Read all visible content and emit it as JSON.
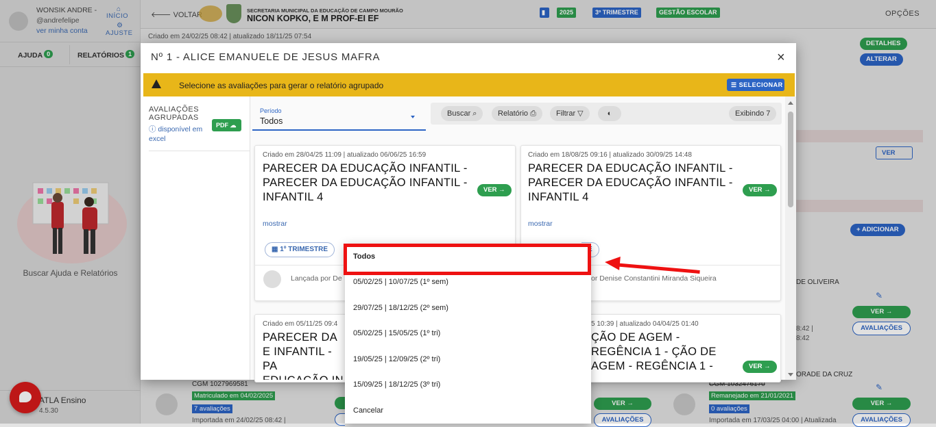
{
  "user": {
    "name": "WONSIK ANDRE -",
    "handle": "@andrefelipe",
    "my_account": "ver minha conta",
    "inicio": "INÍCIO",
    "ajuste": "AJUSTE"
  },
  "side_tabs": {
    "ajuda": "AJUDA",
    "ajuda_count": "0",
    "relatorios": "RELATÓRIOS",
    "relatorios_count": "1"
  },
  "help_text": "Buscar Ajuda e Relatórios",
  "app_footer": {
    "name": "ATLA Ensino",
    "version": "4.5.30"
  },
  "header": {
    "back": "VOLTAR",
    "secretaria": "SECRETARIA MUNICIPAL DA EDUCAÇÃO DE CAMPO MOURÃO",
    "school": "NICON KOPKO, E M PROF-EI EF",
    "chips": [
      "2025",
      "3º TRIMESTRE",
      "GESTÃO ESCOLAR"
    ],
    "options": "OPÇÕES"
  },
  "created_info": "Criado em 24/02/25 08:42 | atualizado 18/11/25 07:54",
  "background": {
    "detalhes": "DETALHES",
    "alterar": "ALTERAR",
    "ver": "VER",
    "adicionar": "+ ADICIONAR",
    "name_right": "DE OLIVEIRA",
    "date_a": "8:42 |",
    "date_b": "8:42",
    "ver_btn": "VER →",
    "avaliacoes": "AVALIAÇÕES",
    "name_strike": "ORADE DA CRUZ",
    "students": [
      {
        "cgm": "CGM 1027969581",
        "status": "Matriculado em 04/02/2025",
        "count": "7 avaliações",
        "imported": "Importada em 24/02/25 08:42 |"
      },
      {
        "cgm": "CGM 1032476170",
        "status": "Remanejado em 21/01/2021",
        "count": "0 avaliações",
        "imported": "Importada em 17/03/25 04:00 | Atualizada"
      }
    ]
  },
  "modal": {
    "title": "Nº 1 - ALICE EMANUELE DE JESUS MAFRA",
    "close": "×",
    "warning": "Selecione as avaliações para gerar o relatório agrupado",
    "select_btn": "SELECIONAR",
    "grouped_title": "AVALIAÇÕES AGRUPADAS",
    "excel_link": "disponível em excel",
    "pdf_btn": "PDF",
    "periodo_label": "Período",
    "periodo_value": "Todos",
    "toolbar": {
      "buscar": "Buscar",
      "relatorio": "Relatório",
      "filtrar": "Filtrar",
      "exibindo": "Exibindo 7"
    },
    "cards": [
      {
        "meta": "Criado em 28/04/25 11:09 | atualizado 06/06/25 16:59",
        "title": "PARECER DA EDUCAÇÃO INFANTIL - PARECER DA EDUCAÇÃO INFANTIL - INFANTIL 4",
        "more": "mostrar",
        "ver": "VER →",
        "pill": "1º TRIMESTRE",
        "lanc": "Lançada por De"
      },
      {
        "meta": "Criado em 18/08/25 09:16 | atualizado 30/09/25 14:48",
        "title": "PARECER DA EDUCAÇÃO INFANTIL - PARECER DA EDUCAÇÃO INFANTIL - INFANTIL 4",
        "more": "mostrar",
        "ver": "VER →",
        "pill": "E",
        "lanc": "or Denise Constantini Miranda Siqueira"
      },
      {
        "meta": "Criado em 05/11/25 09:4",
        "title": "PARECER DA E INFANTIL - PA EDUCAÇÃO IN 4"
      },
      {
        "meta": "5 10:39 | atualizado 04/04/25 01:40",
        "title": "ÇÃO DE AGEM - REGÊNCIA 1 - ÇÃO DE AGEM - REGÊNCIA 1 -",
        "ver": "VER →"
      }
    ]
  },
  "dropdown": {
    "options": [
      "Todos",
      "05/02/25 | 10/07/25 (1º sem)",
      "29/07/25 | 18/12/25 (2º sem)",
      "05/02/25 | 15/05/25 (1º tri)",
      "19/05/25 | 12/09/25 (2º tri)",
      "15/09/25 | 18/12/25 (3º tri)",
      "Cancelar"
    ]
  },
  "colors": {
    "accent": "#2c64c4",
    "green": "#2e9e4f",
    "warning": "#e8b619",
    "highlight": "#ee1111"
  }
}
